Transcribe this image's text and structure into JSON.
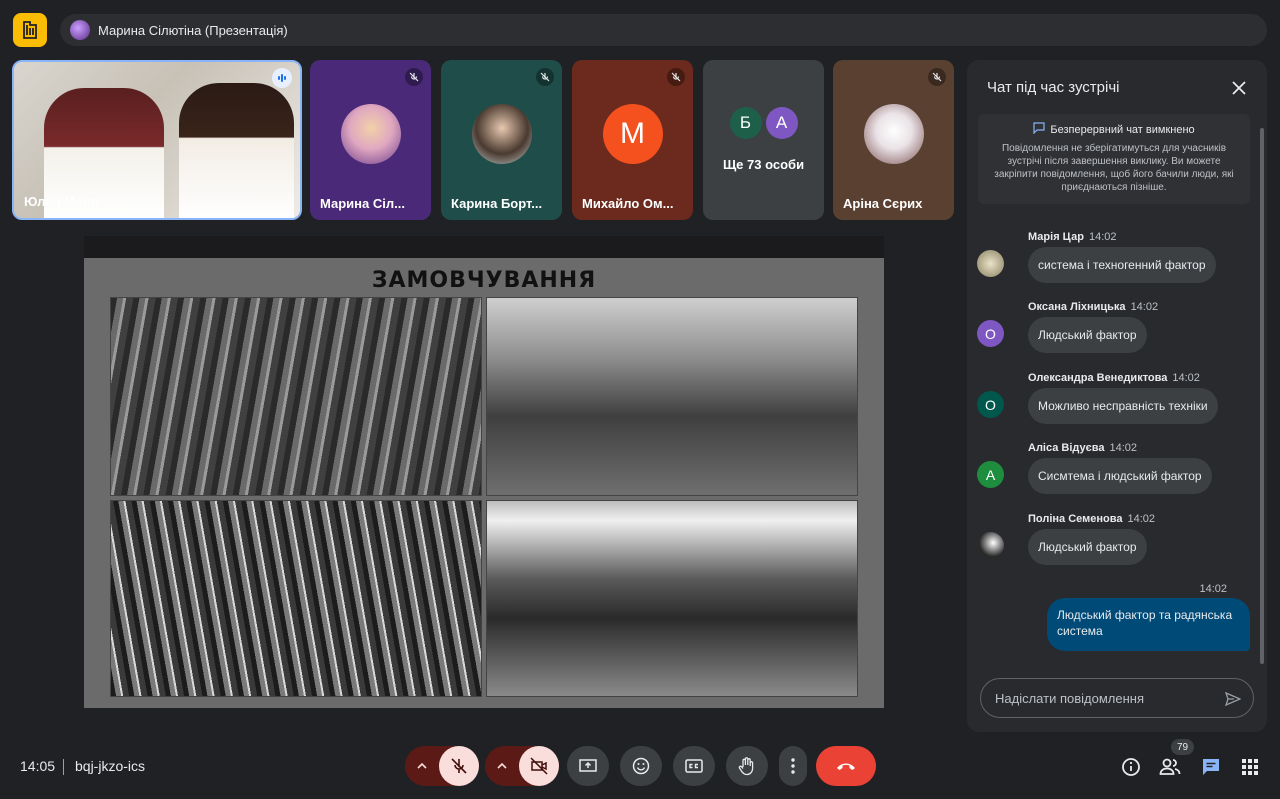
{
  "presenter_bar": {
    "label": "Марина Сілютіна (Презентація)"
  },
  "tiles": {
    "video": {
      "name": "Юлия Моря"
    },
    "marina": {
      "name": "Марина Сіл..."
    },
    "karina": {
      "name": "Карина Борт..."
    },
    "mykhailo": {
      "name": "Михайло Ом...",
      "initial": "М"
    },
    "more": {
      "label": "Ще 73 особи",
      "initials": [
        "Б",
        "А"
      ]
    },
    "arina": {
      "name": "Аріна Сєрих"
    }
  },
  "slide": {
    "title": "ЗАМОВЧУВАННЯ"
  },
  "chat": {
    "title": "Чат під час зустрічі",
    "notice_head": "Безперервний чат вимкнено",
    "notice_body": "Повідомлення не зберігатимуться для учасників зустрічі після завершення виклику. Ви можете закріпити повідомлення, щоб його бачили люди, які приєднаються пізніше.",
    "messages": [
      {
        "author": "Марія Цар",
        "time": "14:02",
        "text": "система і техногенний фактор"
      },
      {
        "author": "Оксана Ліхницька",
        "time": "14:02",
        "text": "Людський фактор",
        "initial": "О"
      },
      {
        "author": "Олександра Венедиктова",
        "time": "14:02",
        "text": "Можливо несправність техніки",
        "initial": "О"
      },
      {
        "author": "Аліса Відуєва",
        "time": "14:02",
        "text": "Сисмтема і людський фактор",
        "initial": "А"
      },
      {
        "author": "Поліна Семенова",
        "time": "14:02",
        "text": "Людський фактор"
      }
    ],
    "own_message": {
      "time": "14:02",
      "text": "Людський фактор та радянська система"
    },
    "input_placeholder": "Надіслати повідомлення"
  },
  "bottom": {
    "time": "14:05",
    "meeting_code": "bqj-jkzo-ics",
    "participants_count": "79"
  },
  "colors": {
    "accent": "#8ab4f8",
    "end_call": "#ea4335",
    "logo": "#fbbc04",
    "own_bubble": "#004a77"
  }
}
